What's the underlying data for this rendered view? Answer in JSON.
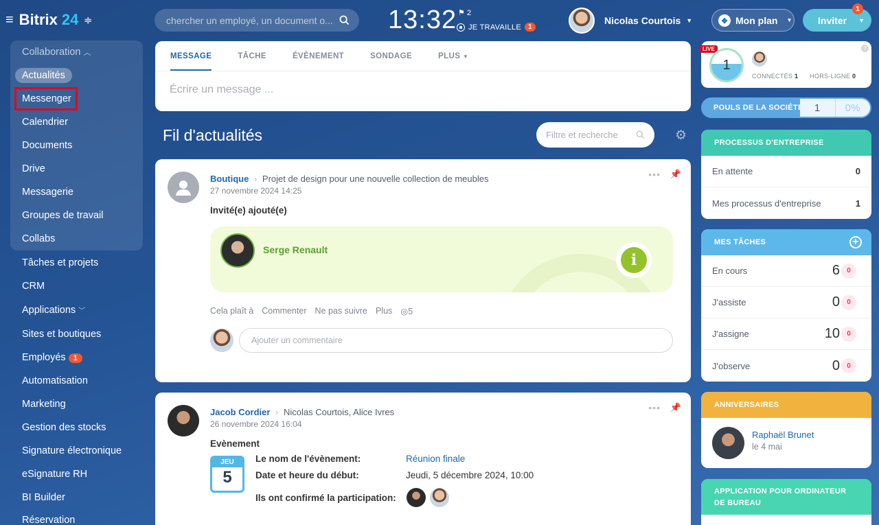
{
  "header": {
    "logo_text": "Bitrix",
    "logo_num": "24",
    "search_placeholder": "chercher un employé, un document o...",
    "time": "13:32",
    "flags_count": "2",
    "work_status": "JE TRAVAILLE",
    "work_badge": "1",
    "user_name": "Nicolas Courtois",
    "plan_label": "Mon plan",
    "invite_label": "Inviter",
    "invite_badge": "1"
  },
  "sidebar": {
    "group_title": "Collaboration",
    "group_items": [
      "Actualités",
      "Messenger",
      "Calendrier",
      "Documents",
      "Drive",
      "Messagerie",
      "Groupes de travail",
      "Collabs"
    ],
    "items": [
      "Tâches et projets",
      "CRM",
      "Applications",
      "Sites et boutiques",
      "Employés",
      "Automatisation",
      "Marketing",
      "Gestion des stocks",
      "Signature électronique",
      "eSignature RH",
      "BI Builder",
      "Réservation"
    ],
    "employes_badge": "1"
  },
  "composer": {
    "tabs": [
      "MESSAGE",
      "TÂCHE",
      "ÉVÈNEMENT",
      "SONDAGE",
      "PLUS"
    ],
    "placeholder": "Écrire un message ..."
  },
  "feed": {
    "title": "Fil d'actualités",
    "filter_placeholder": "Filtre et recherche",
    "post1": {
      "author": "Boutique",
      "target": "Projet de design pour une nouvelle collection de meubles",
      "date": "27 novembre 2024 14:25",
      "type": "Invité(e) ajouté(e)",
      "guest_name": "Serge Renault",
      "actions": [
        "Cela plaît à",
        "Commenter",
        "Ne pas suivre",
        "Plus"
      ],
      "views": "5",
      "comment_placeholder": "Ajouter un commentaire"
    },
    "post2": {
      "author": "Jacob Cordier",
      "target": "Nicolas Courtois, Alice Ivres",
      "date": "26 novembre 2024 16:04",
      "type": "Evènement",
      "cal_day_name": "JEU",
      "cal_day": "5",
      "event_name_label": "Le nom de l'évènement:",
      "event_name": "Réunion finale",
      "event_start_label": "Date et heure du début:",
      "event_start": "Jeudi, 5 décembre 2024, 10:00",
      "event_confirmed_label": "Ils ont confirmé la participation:"
    }
  },
  "right": {
    "live_label": "LIVE",
    "live_count": "1",
    "connected_label": "CONNECTÉS",
    "connected_count": "1",
    "offline_label": "HORS-LIGNE",
    "offline_count": "0",
    "pouls_label": "POULS DE LA SOCIÉTÉ",
    "pouls_value": "1",
    "pouls_pct": "0%",
    "bp_title": "PROCESSUS D'ENTREPRISE",
    "bp_rows": [
      {
        "label": "En attente",
        "value": "0"
      },
      {
        "label": "Mes processus d'entreprise",
        "value": "1"
      }
    ],
    "tasks_title": "MES TÂCHES",
    "tasks_rows": [
      {
        "label": "En cours",
        "value": "6",
        "badge": "0"
      },
      {
        "label": "J'assiste",
        "value": "0",
        "badge": "0"
      },
      {
        "label": "J'assigne",
        "value": "10",
        "badge": "0"
      },
      {
        "label": "J'observe",
        "value": "0",
        "badge": "0"
      }
    ],
    "birthdays_title": "ANNIVERSAIRES",
    "birthday_name": "Raphaël Brunet",
    "birthday_date": "le 4 mai",
    "desktop_title": "APPLICATION POUR ORDINATEUR DE BUREAU"
  },
  "colors": {
    "accent_blue": "#2067b0",
    "tasks_header": "#5cb8ea",
    "bp_header": "#3ec9b0",
    "birthday_header": "#f1b33e",
    "desktop_header": "#48d5b1",
    "badge_red": "#f55733"
  }
}
